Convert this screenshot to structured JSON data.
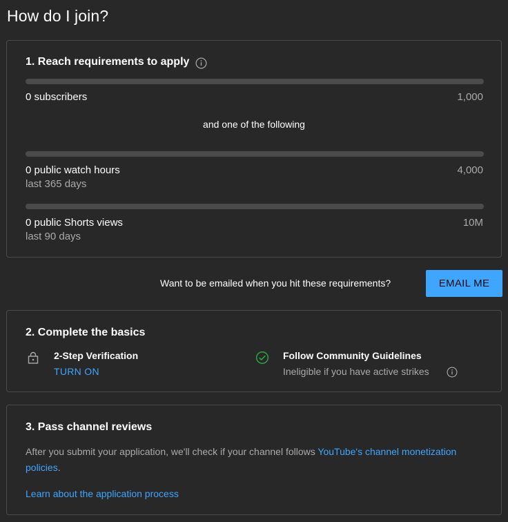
{
  "page": {
    "title": "How do I join?"
  },
  "requirements": {
    "title": "1. Reach requirements to apply",
    "items": [
      {
        "label": "0 subscribers",
        "sublabel": "",
        "target": "1,000",
        "progress": 0
      },
      {
        "label": "0 public watch hours",
        "sublabel": "last 365 days",
        "target": "4,000",
        "progress": 0
      },
      {
        "label": "0 public Shorts views",
        "sublabel": "last 90 days",
        "target": "10M",
        "progress": 0
      }
    ],
    "separator": "and one of the following"
  },
  "email_prompt": {
    "text": "Want to be emailed when you hit these requirements?",
    "button_label": "EMAIL ME"
  },
  "basics": {
    "title": "2. Complete the basics",
    "two_step": {
      "title": "2-Step Verification",
      "action_label": "TURN ON"
    },
    "guidelines": {
      "title": "Follow Community Guidelines",
      "subtitle": "Ineligible if you have active strikes"
    }
  },
  "reviews": {
    "title": "3. Pass channel reviews",
    "text_before": "After you submit your application, we'll check if your channel follows ",
    "link_text": "YouTube's channel monetization policies",
    "text_after": ".",
    "learn_link": "Learn about the application process"
  },
  "colors": {
    "accent": "#3ea6ff",
    "check": "#2ba640",
    "background": "#282828"
  }
}
